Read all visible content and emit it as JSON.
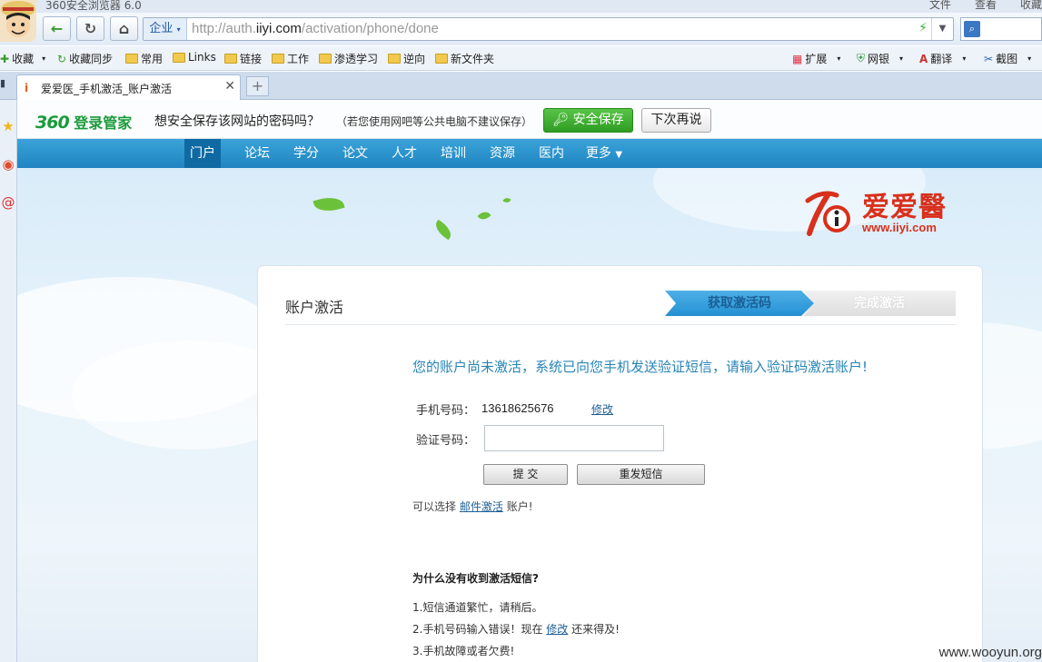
{
  "browser": {
    "title": "360安全浏览器 6.0",
    "menu": [
      "文件",
      "查看",
      "收藏"
    ],
    "zone_label": "企业",
    "url_prefix": "http://auth.",
    "url_domain": "iiyi.com",
    "url_path": "/activation/phone/done",
    "bookmarks": [
      "收藏",
      "收藏同步",
      "常用",
      "Links",
      "链接",
      "工作",
      "渗透学习",
      "逆向",
      "新文件夹"
    ],
    "tools": [
      "扩展",
      "网银",
      "翻译",
      "截图"
    ],
    "tab_title": "爱爱医_手机激活_账户激活",
    "new_tab": "+"
  },
  "password_bar": {
    "logo_num": "360",
    "logo_text": "登录管家",
    "question": "想安全保存该网站的密码吗？",
    "note": "（若您使用网吧等公共电脑不建议保存）",
    "save": "安全保存",
    "later": "下次再说"
  },
  "site_nav": [
    "门户",
    "论坛",
    "学分",
    "论文",
    "人才",
    "培训",
    "资源",
    "医内",
    "更多"
  ],
  "site_logo": {
    "cn": "爱爱醫",
    "en": "www.iiyi.com"
  },
  "card": {
    "title": "账户激活",
    "step1": "获取激活码",
    "step2": "完成激活",
    "message": "您的账户尚未激活，系统已向您手机发送验证短信，请输入验证码激活账户!",
    "phone_label": "手机号码：",
    "phone_value": "13618625676",
    "modify": "修改",
    "code_label": "验证号码：",
    "submit": "提 交",
    "resend": "重发短信",
    "alt_prefix": "可以选择",
    "alt_link": "邮件激活",
    "alt_suffix": "账户!",
    "faq_title": "为什么没有收到激活短信?",
    "faq1": "1.短信通道繁忙，请稍后。",
    "faq2_prefix": "2.手机号码输入错误！现在",
    "faq2_link": "修改",
    "faq2_suffix": "还来得及!",
    "faq3": "3.手机故障或者欠费!"
  },
  "watermark": "www.wooyun.org"
}
